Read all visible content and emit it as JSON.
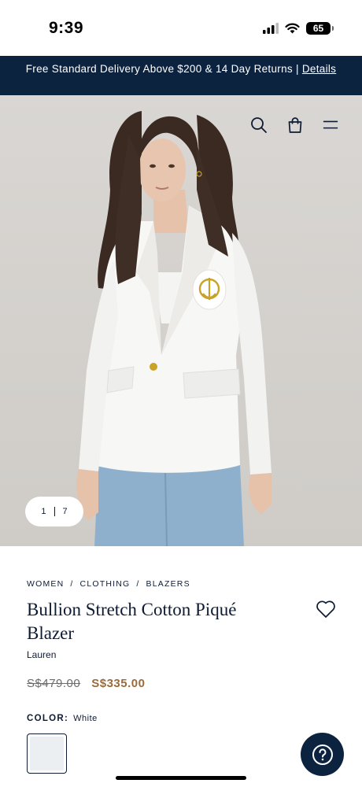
{
  "status": {
    "time": "9:39",
    "battery": "65"
  },
  "promo": {
    "text": "Free Standard Delivery Above $200 & 14 Day Returns | ",
    "link": "Details"
  },
  "hero": {
    "counter_current": "1",
    "counter_total": "7"
  },
  "icons": {
    "search": "search-icon",
    "bag": "shopping-bag-icon",
    "menu": "menu-icon",
    "wishlist": "heart-icon",
    "help": "question-icon"
  },
  "breadcrumb": [
    "WOMEN",
    "CLOTHING",
    "BLAZERS"
  ],
  "product": {
    "title": "Bullion Stretch Cotton Piqué Blazer",
    "brand": "Lauren",
    "price_original": "S$479.00",
    "price_sale": "S$335.00",
    "color_label": "COLOR:",
    "color_value": "White"
  },
  "colors": {
    "navy": "#0c2340",
    "sale": "#9a6b3c",
    "swatch_white": "#eceff2"
  }
}
